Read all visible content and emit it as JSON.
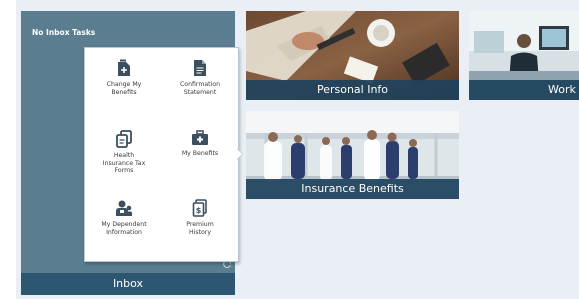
{
  "inbox": {
    "status": "No Inbox Tasks",
    "label": "Inbox"
  },
  "menu": {
    "items": [
      {
        "label": "Change My\nBenefits",
        "icon": "change-benefits-icon"
      },
      {
        "label": "Confirmation\nStatement",
        "icon": "document-icon"
      },
      {
        "label": "Health\nInsurance Tax\nForms",
        "icon": "tax-forms-icon"
      },
      {
        "label": "My Benefits",
        "icon": "medical-kit-icon"
      },
      {
        "label": "My Dependent\nInformation",
        "icon": "dependents-icon"
      },
      {
        "label": "Premium\nHistory",
        "icon": "history-icon"
      }
    ]
  },
  "tiles": {
    "personal_info": "Personal Info",
    "work": "Work",
    "insurance_benefits": "Insurance Benefits"
  },
  "colors": {
    "inbox_bg": "#5a7d90",
    "inbox_footer": "#2d5670",
    "tile_label_bg": "#1e425c",
    "icon": "#3c4f5e"
  }
}
